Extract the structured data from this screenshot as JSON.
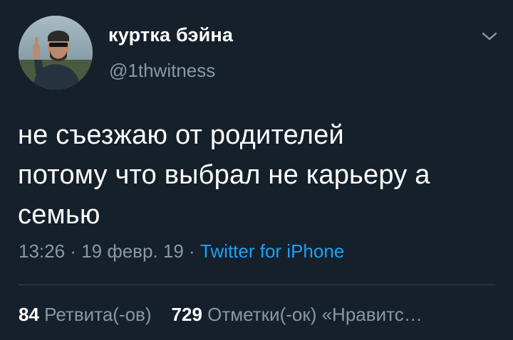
{
  "user": {
    "display_name": "куртка бэйна",
    "handle": "@1thwitness"
  },
  "tweet": {
    "line1": "не съезжаю от родителей",
    "line2": "потому что выбрал не карьеру а",
    "line3": "семью"
  },
  "meta": {
    "time": "13:26",
    "sep1": " · ",
    "date": "19 февр. 19",
    "sep2": " · ",
    "source": "Twitter for iPhone"
  },
  "stats": {
    "retweets_count": "84",
    "retweets_label": "Ретвита(-ов)",
    "likes_count": "729",
    "likes_label": "Отметки(-ок) «Нравитс…"
  },
  "icons": {
    "menu": "chevron-down-icon",
    "avatar": "avatar"
  },
  "colors": {
    "background": "#15202b",
    "text_primary": "#ffffff",
    "text_secondary": "#8899a6",
    "link": "#1da1f2",
    "divider": "#38444d"
  }
}
